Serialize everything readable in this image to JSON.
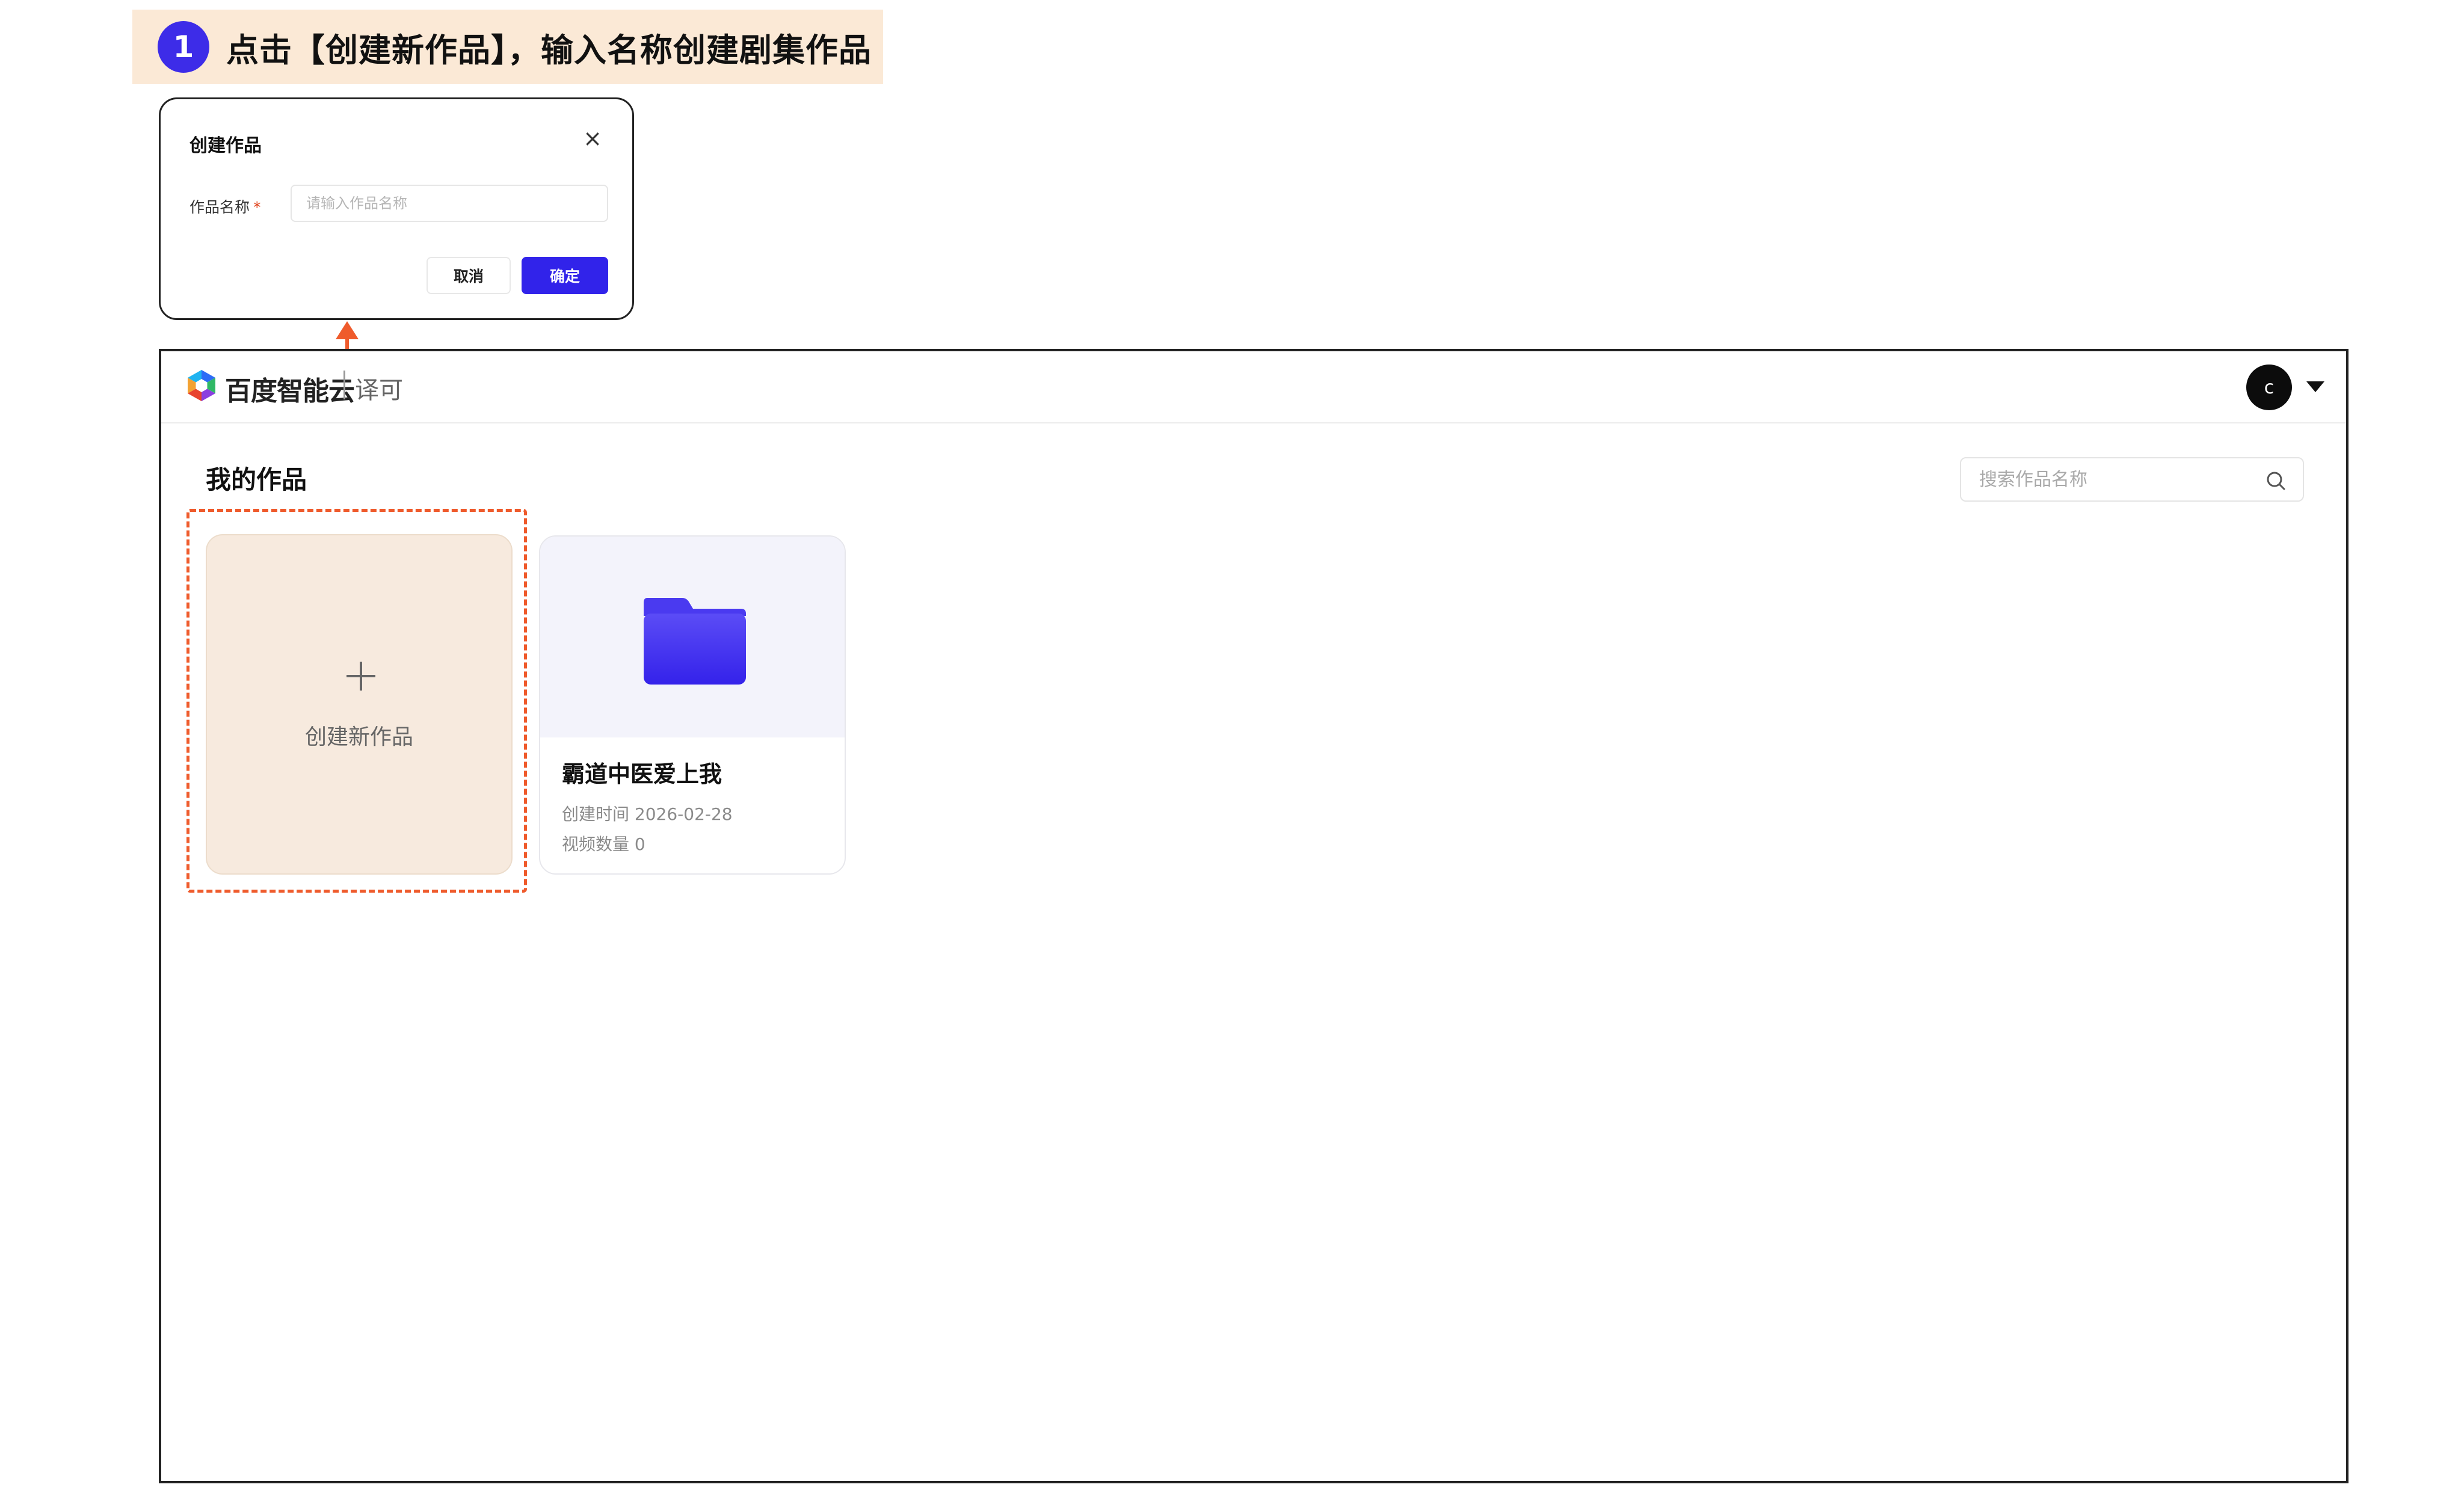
{
  "step": {
    "number": "1",
    "instruction": "点击【创建新作品】，输入名称创建剧集作品"
  },
  "dialog": {
    "title": "创建作品",
    "close_glyph": "×",
    "field_label": "作品名称",
    "required_mark": "*",
    "field_placeholder": "请输入作品名称",
    "field_value": "",
    "cancel_label": "取消",
    "confirm_label": "确定"
  },
  "header": {
    "brand": "百度智能云",
    "product": "译可",
    "avatar_initial": "c",
    "logo_icon": "baidu-cloud-logo-icon",
    "caret_icon": "caret-down-icon"
  },
  "main": {
    "section_title": "我的作品",
    "search": {
      "placeholder": "搜索作品名称",
      "value": "",
      "icon": "search-icon"
    },
    "create_card": {
      "label": "创建新作品",
      "icon": "plus-icon"
    },
    "works": [
      {
        "title": "霸道中医爱上我",
        "created": "创建时间 2026-02-28",
        "videos": "视频数量 0",
        "icon": "folder-icon"
      }
    ]
  },
  "colors": {
    "accent": "#3123ea",
    "highlight": "#ef5b2c",
    "create_card_bg": "#f7eade",
    "step_banner_bg": "#fbe9d6",
    "folder": "#3f2cf0"
  }
}
